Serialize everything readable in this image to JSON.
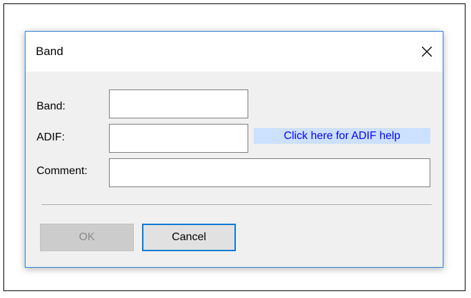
{
  "dialog": {
    "title": "Band",
    "close_icon": "close-icon"
  },
  "form": {
    "band_label": "Band:",
    "band_value": "",
    "adif_label": "ADIF:",
    "adif_value": "",
    "adif_help_link": "Click here for ADIF help",
    "comment_label": "Comment:",
    "comment_value": ""
  },
  "buttons": {
    "ok_label": "OK",
    "cancel_label": "Cancel"
  },
  "colors": {
    "dialog_border": "#2b7cd3",
    "link_text": "#0000ff",
    "link_background": "#cce0ff",
    "focused_button_border": "#0078d7",
    "disabled_button_bg": "#cccccc"
  }
}
